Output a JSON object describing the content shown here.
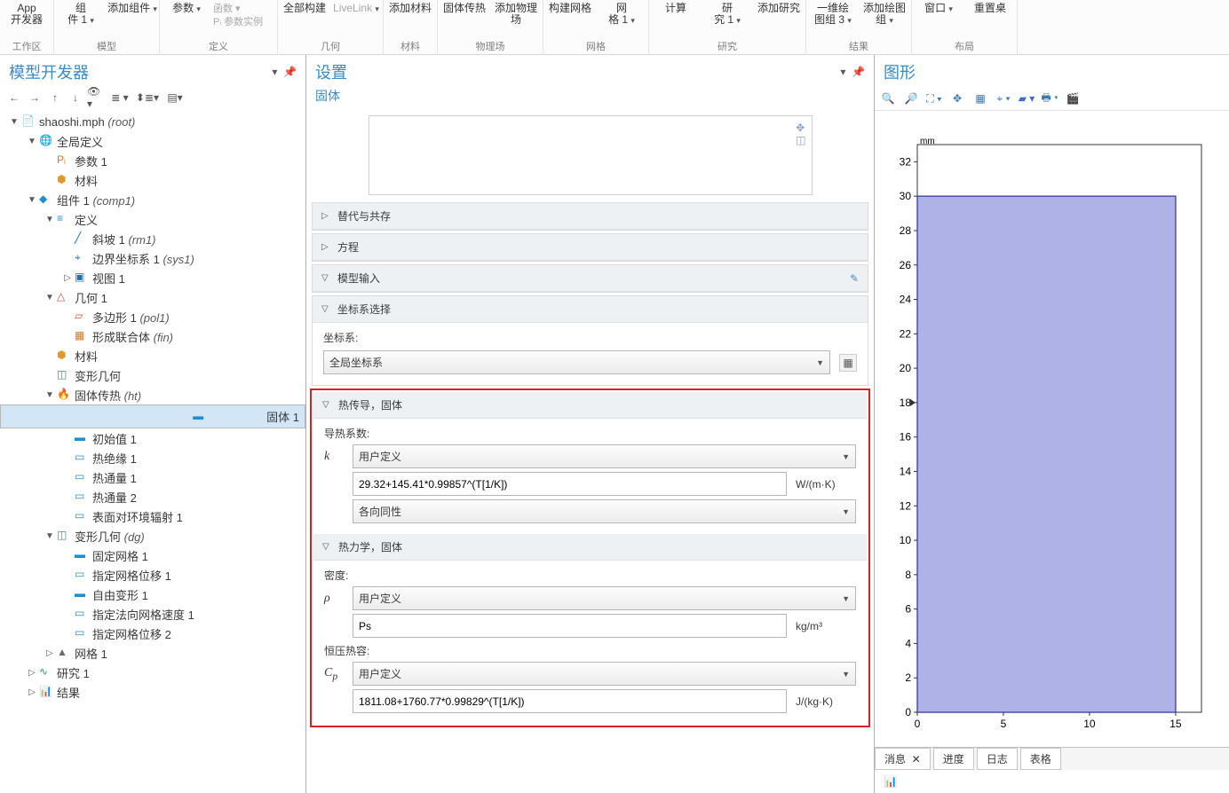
{
  "ribbon": {
    "groups": [
      {
        "label": "工作区",
        "items": [
          {
            "t1": "App",
            "t2": "开发器",
            "icon": "app"
          }
        ]
      },
      {
        "label": "模型",
        "items": [
          {
            "t1": "组",
            "t2": "件 1",
            "dd": true
          },
          {
            "t1": "添加组件",
            "t2": "",
            "dd": true
          }
        ]
      },
      {
        "label": "定义",
        "items": [
          {
            "t1": "参数",
            "dd": true,
            "blue": false
          },
          {
            "t1": "",
            "t2": "",
            "gray": true,
            "two": [
              {
                "txt": "函数",
                "dd": true,
                "gray": true
              },
              {
                "txt": "参数实例",
                "gray": true,
                "pi": true
              }
            ]
          }
        ]
      },
      {
        "label": "几何",
        "items": [
          {
            "t1": "全部构建"
          },
          {
            "t1": "LiveLink",
            "gray": true,
            "t2": "",
            "dd": true
          }
        ]
      },
      {
        "label": "材料",
        "items": [
          {
            "t1": "添加材料"
          }
        ]
      },
      {
        "label": "物理场",
        "items": [
          {
            "t1": "固体传热"
          },
          {
            "t1": "添加物理场"
          }
        ]
      },
      {
        "label": "网格",
        "items": [
          {
            "t1": "构建网格"
          },
          {
            "t1": "网",
            "t2": "格 1",
            "dd": true
          }
        ]
      },
      {
        "label": "研究",
        "items": [
          {
            "t1": "计算"
          },
          {
            "t1": "研",
            "t2": "究 1",
            "dd": true
          },
          {
            "t1": "添加研究"
          }
        ]
      },
      {
        "label": "结果",
        "items": [
          {
            "t1": "一维绘",
            "t2": "图组 3",
            "dd": true
          },
          {
            "t1": "添加绘图组",
            "dd": true
          }
        ]
      },
      {
        "label": "布局",
        "items": [
          {
            "t1": "窗口",
            "dd": true
          },
          {
            "t1": "重置桌"
          }
        ]
      }
    ]
  },
  "model": {
    "title": "模型开发器",
    "tree": [
      {
        "d": 0,
        "tw": "▼",
        "i": "doc",
        "l": "shaoshi.mph",
        "it": " (root)"
      },
      {
        "d": 1,
        "tw": "▼",
        "i": "globe",
        "l": "全局定义"
      },
      {
        "d": 2,
        "tw": "",
        "i": "pi",
        "l": "参数 1"
      },
      {
        "d": 2,
        "tw": "",
        "i": "mat",
        "l": "材料"
      },
      {
        "d": 1,
        "tw": "▼",
        "i": "comp",
        "l": "组件 1",
        "it": "  (comp1)"
      },
      {
        "d": 2,
        "tw": "▼",
        "i": "def",
        "l": "定义"
      },
      {
        "d": 3,
        "tw": "",
        "i": "ramp",
        "l": "斜坡 1",
        "it": "  (rm1)"
      },
      {
        "d": 3,
        "tw": "",
        "i": "csys",
        "l": "边界坐标系 1",
        "it": "  (sys1)"
      },
      {
        "d": 3,
        "tw": "▷",
        "i": "view",
        "l": "视图 1"
      },
      {
        "d": 2,
        "tw": "▼",
        "i": "geom",
        "l": "几何 1"
      },
      {
        "d": 3,
        "tw": "",
        "i": "poly",
        "l": "多边形 1",
        "it": "  (pol1)"
      },
      {
        "d": 3,
        "tw": "",
        "i": "union",
        "l": "形成联合体",
        "it": "  (fin)"
      },
      {
        "d": 2,
        "tw": "",
        "i": "mat",
        "l": "材料"
      },
      {
        "d": 2,
        "tw": "",
        "i": "dgeom",
        "l": "变形几何"
      },
      {
        "d": 2,
        "tw": "▼",
        "i": "ht",
        "l": "固体传热",
        "it": "  (ht)"
      },
      {
        "d": 3,
        "tw": "",
        "i": "solid",
        "l": "固体 1",
        "sel": true
      },
      {
        "d": 3,
        "tw": "",
        "i": "iv",
        "l": "初始值 1"
      },
      {
        "d": 3,
        "tw": "",
        "i": "ins",
        "l": "热绝缘 1"
      },
      {
        "d": 3,
        "tw": "",
        "i": "flux",
        "l": "热通量 1"
      },
      {
        "d": 3,
        "tw": "",
        "i": "flux",
        "l": "热通量 2"
      },
      {
        "d": 3,
        "tw": "",
        "i": "rad",
        "l": "表面对环境辐射 1"
      },
      {
        "d": 2,
        "tw": "▼",
        "i": "dgeom",
        "l": "变形几何",
        "it": "  (dg)"
      },
      {
        "d": 3,
        "tw": "",
        "i": "fmesh",
        "l": "固定网格 1"
      },
      {
        "d": 3,
        "tw": "",
        "i": "mgrid",
        "l": "指定网格位移 1"
      },
      {
        "d": 3,
        "tw": "",
        "i": "free",
        "l": "自由变形 1"
      },
      {
        "d": 3,
        "tw": "",
        "i": "mgrid",
        "l": "指定法向网格速度 1"
      },
      {
        "d": 3,
        "tw": "",
        "i": "mgrid",
        "l": "指定网格位移 2"
      },
      {
        "d": 2,
        "tw": "▷",
        "i": "mesh",
        "l": "网格 1"
      },
      {
        "d": 1,
        "tw": "▷",
        "i": "study",
        "l": "研究 1"
      },
      {
        "d": 1,
        "tw": "▷",
        "i": "res",
        "l": "结果"
      }
    ]
  },
  "settings": {
    "title": "设置",
    "sub": "固体",
    "sections": {
      "s1": "替代与共存",
      "s2": "方程",
      "s3": "模型输入",
      "s4": "坐标系选择",
      "s5": "热传导，固体",
      "s6": "热力学，固体"
    },
    "coord": {
      "label": "坐标系:",
      "val": "全局坐标系"
    },
    "k": {
      "label": "导热系数:",
      "sym": "k",
      "sel": "用户定义",
      "expr": "29.32+145.41*0.99857^(T[1/K])",
      "unit": "W/(m·K)",
      "iso": "各向同性"
    },
    "rho": {
      "label": "密度:",
      "sym": "ρ",
      "sel": "用户定义",
      "expr": "Ps",
      "unit": "kg/m³"
    },
    "cp": {
      "label": "恒压热容:",
      "sym": "C",
      "sub": "p",
      "sel": "用户定义",
      "expr": "1811.08+1760.77*0.99829^(T[1/K])",
      "unit": "J/(kg·K)"
    }
  },
  "graph": {
    "title": "图形",
    "mm": "mm",
    "tabs": [
      "消息",
      "进度",
      "日志",
      "表格"
    ]
  },
  "chart_data": {
    "type": "area",
    "title": "",
    "xlabel": "",
    "ylabel": "",
    "unitlabel": "mm",
    "xlim": [
      0,
      16.5
    ],
    "ylim": [
      0,
      33
    ],
    "xticks": [
      0,
      5,
      10,
      15
    ],
    "yticks": [
      0,
      2,
      4,
      6,
      8,
      10,
      12,
      14,
      16,
      18,
      20,
      22,
      24,
      26,
      28,
      30,
      32
    ],
    "domain": {
      "x": [
        0,
        15
      ],
      "y": [
        0,
        30
      ]
    }
  }
}
